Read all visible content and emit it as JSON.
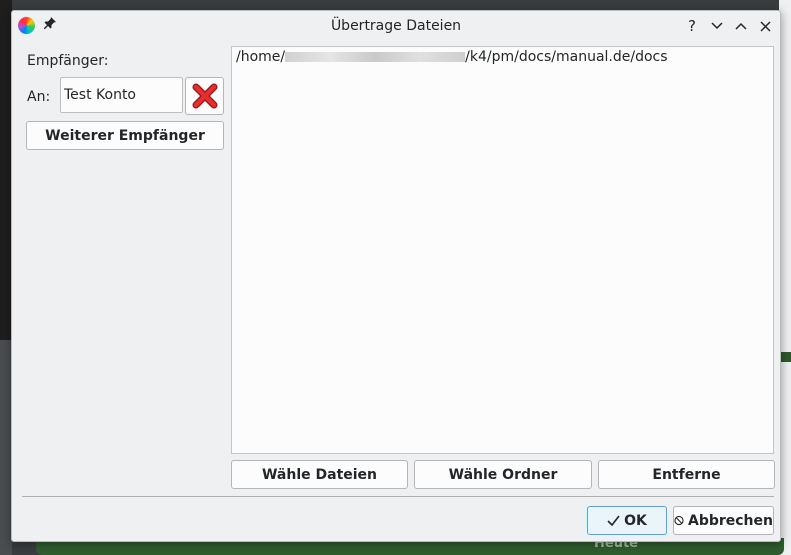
{
  "window": {
    "title": "Übertrage Dateien",
    "controls": {
      "help": "?",
      "minimize": "⌄",
      "maximize": "⌃",
      "close": "✕"
    }
  },
  "recipients": {
    "section_label": "Empfänger:",
    "to_label": "An:",
    "to_value": "Test Konto",
    "remove_icon": "red-x-icon",
    "add_button": "Weiterer Empfänger"
  },
  "files": {
    "items": [
      {
        "prefix": "/home/",
        "suffix": "/k4/pm/docs/manual.de/docs"
      }
    ],
    "buttons": {
      "choose_files": "Wähle Dateien",
      "choose_folder": "Wähle Ordner",
      "remove": "Entferne"
    }
  },
  "footer": {
    "ok_label": "OK",
    "cancel_label": "Abbrechen"
  },
  "background": {
    "bottom_text": "Heute"
  },
  "colors": {
    "accent": "#3daee9",
    "remove_icon": "#d32020",
    "window_bg": "#eff0f1"
  }
}
